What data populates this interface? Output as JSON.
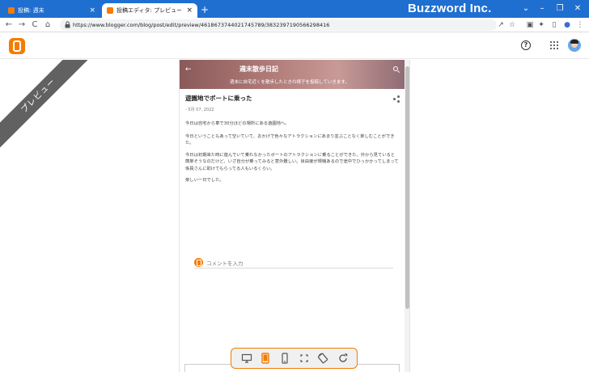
{
  "browser": {
    "tabs": [
      {
        "label": "投稿: 週末",
        "favicon": "blogger-icon",
        "close": "×"
      },
      {
        "label": "投稿エディタ: プレビュー",
        "favicon": "blogger-icon",
        "close": "×"
      }
    ],
    "new_tab": "+",
    "brand": "Buzzword Inc.",
    "window_controls": [
      "⌄",
      "–",
      "❐",
      "✕"
    ],
    "nav": [
      "←",
      "→",
      "C",
      "⌂"
    ],
    "url": "https://www.blogger.com/blog/post/edit/preview/4618673744021745789/3832397190566298416",
    "toolbar_icons": [
      "↗",
      "☆",
      "▣",
      "✦",
      "▯",
      "●",
      "⋮"
    ]
  },
  "blogger": {
    "help": "?",
    "ribbon": "プレビュー"
  },
  "blog": {
    "back": "←",
    "title": "週末散歩日記",
    "description": "週末に自宅近くを散歩したときの様子を投稿していきます。"
  },
  "post": {
    "title": "遊園地でボートに乗った",
    "date": "- 5月 07, 2022",
    "paragraphs": [
      "今日は自宅から車で30分ほどの場所にある遊園地へ。",
      "今日ということもあって空いていて、おかげで色々なアトラクションにあまり並ぶことなく楽しむことができた。",
      "今日は初期来た時に遊んでいて乗れなかったボートのアトラクションに乗ることができた。外から見ていると簡単そうなのだけど、いざ自分が乗ってみると意外難しい。目由度が規機あるので途中でひっかかってしまって係員さんに助けてもらってる人もいるくらい。",
      "楽しい一日でした。"
    ],
    "comment_placeholder": "コメントを入力"
  },
  "colors": {
    "brand_blue": "#1f6fd1",
    "blogger_orange": "#f57c00",
    "ribbon": "#616161"
  },
  "preview_toolbar": [
    "desktop-icon",
    "tablet-icon",
    "phone-icon",
    "fullscreen-icon",
    "rotate-icon",
    "refresh-icon"
  ]
}
